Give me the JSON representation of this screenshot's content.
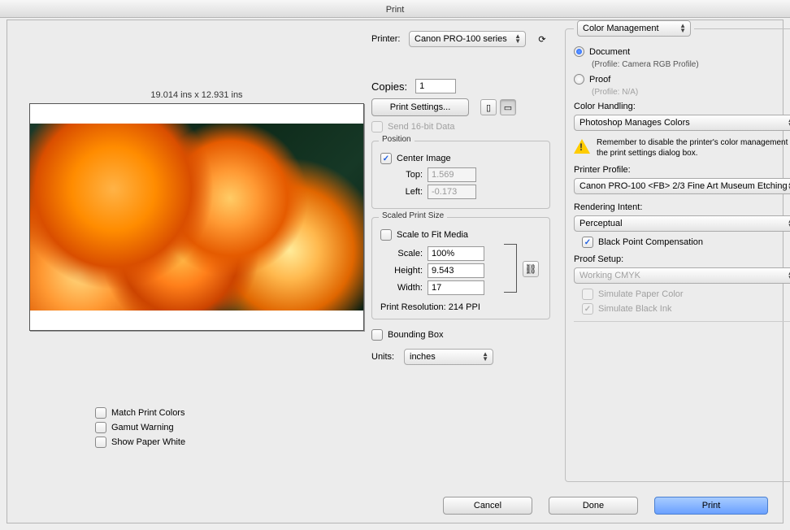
{
  "window": {
    "title": "Print"
  },
  "printer": {
    "label": "Printer:",
    "value": "Canon PRO-100 series"
  },
  "copies": {
    "label": "Copies:",
    "value": "1"
  },
  "print_settings_label": "Print Settings...",
  "send16bit": {
    "label": "Send 16-bit Data"
  },
  "preview": {
    "dims": "19.014 ins x 12.931 ins"
  },
  "left_checks": {
    "match": "Match Print Colors",
    "gamut": "Gamut Warning",
    "paper": "Show Paper White"
  },
  "position": {
    "title": "Position",
    "center": "Center Image",
    "top_label": "Top:",
    "top_value": "1.569",
    "left_label": "Left:",
    "left_value": "-0.173"
  },
  "scaled": {
    "title": "Scaled Print Size",
    "fit": "Scale to Fit Media",
    "scale_label": "Scale:",
    "scale_value": "100%",
    "height_label": "Height:",
    "height_value": "9.543",
    "width_label": "Width:",
    "width_value": "17",
    "res": "Print Resolution: 214 PPI"
  },
  "bounding": "Bounding Box",
  "units": {
    "label": "Units:",
    "value": "inches"
  },
  "right": {
    "section": "Color Management",
    "document": "Document",
    "document_profile": "(Profile: Camera RGB Profile)",
    "proof": "Proof",
    "proof_profile": "(Profile: N/A)",
    "handling_label": "Color Handling:",
    "handling_value": "Photoshop Manages Colors",
    "warn": "Remember to disable the printer's color management in the print settings dialog box.",
    "profile_label": "Printer Profile:",
    "profile_value": "Canon PRO-100 <FB> 2/3 Fine Art Museum Etching",
    "intent_label": "Rendering Intent:",
    "intent_value": "Perceptual",
    "bpc": "Black Point Compensation",
    "proof_setup_label": "Proof Setup:",
    "proof_setup_value": "Working CMYK",
    "sim_paper": "Simulate Paper Color",
    "sim_black": "Simulate Black Ink"
  },
  "footer": {
    "cancel": "Cancel",
    "done": "Done",
    "print": "Print"
  }
}
